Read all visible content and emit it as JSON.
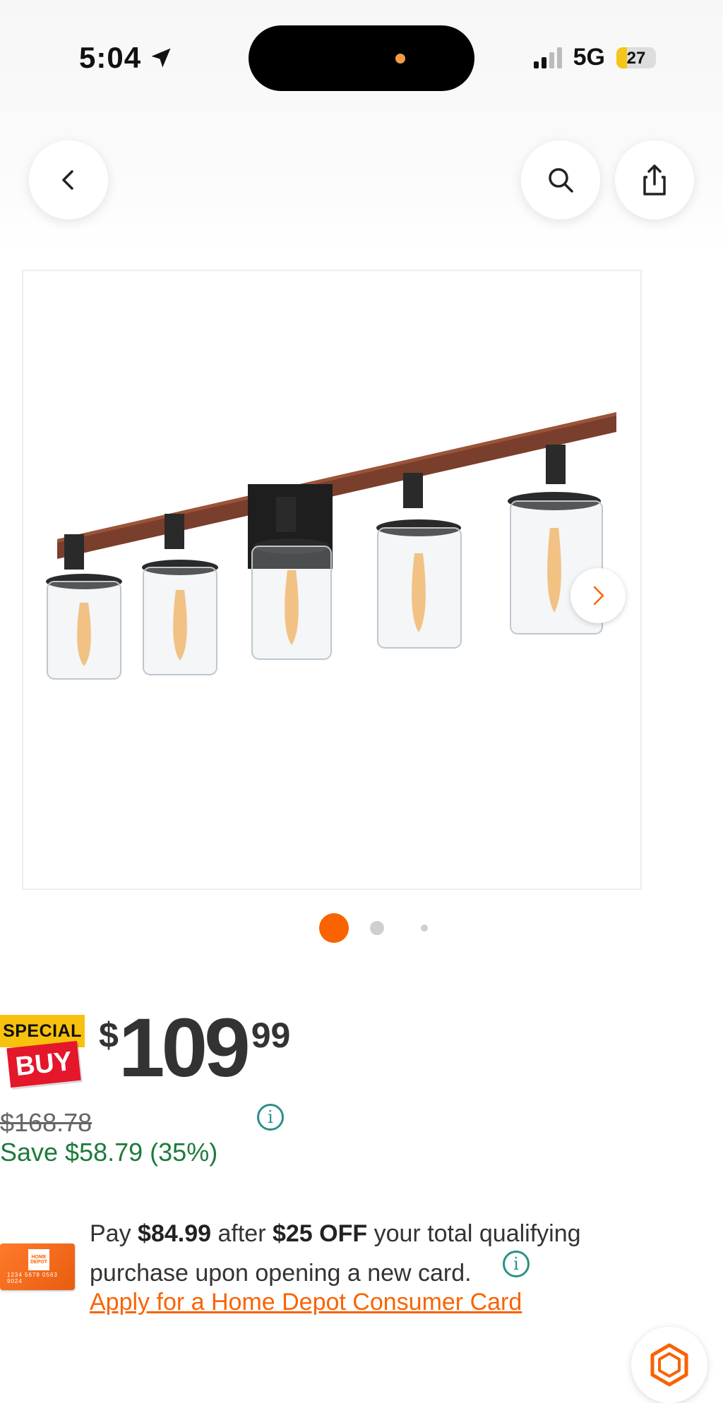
{
  "status_bar": {
    "time": "5:04",
    "network": "5G",
    "battery": "27",
    "battery_level": 0.27
  },
  "nav": {
    "back": "back",
    "search": "search",
    "share": "share"
  },
  "gallery": {
    "image": "5-light vanity light fixture with wood beam and clear glass shades",
    "current_index": 1,
    "total": 3
  },
  "badge": {
    "special": "SPECIAL",
    "buy": "BUY"
  },
  "price": {
    "currency": "$",
    "dollars": "109",
    "cents": "99",
    "was": "$168.78",
    "save": "Save $58.79 (35%)"
  },
  "promo": {
    "pay_prefix": "Pay ",
    "pay_amount": "$84.99",
    "after": " after ",
    "off": "$25 OFF",
    "rest": " your total qualifying purchase upon opening a new card.",
    "apply_link": "Apply for a Home Depot Consumer Card"
  },
  "card": {
    "logo": "HOME DEPOT",
    "number": "1234 5678 0563 9024"
  },
  "colors": {
    "accent": "#f96302",
    "save_green": "#1e7a3c",
    "info_teal": "#2a8f8a"
  }
}
